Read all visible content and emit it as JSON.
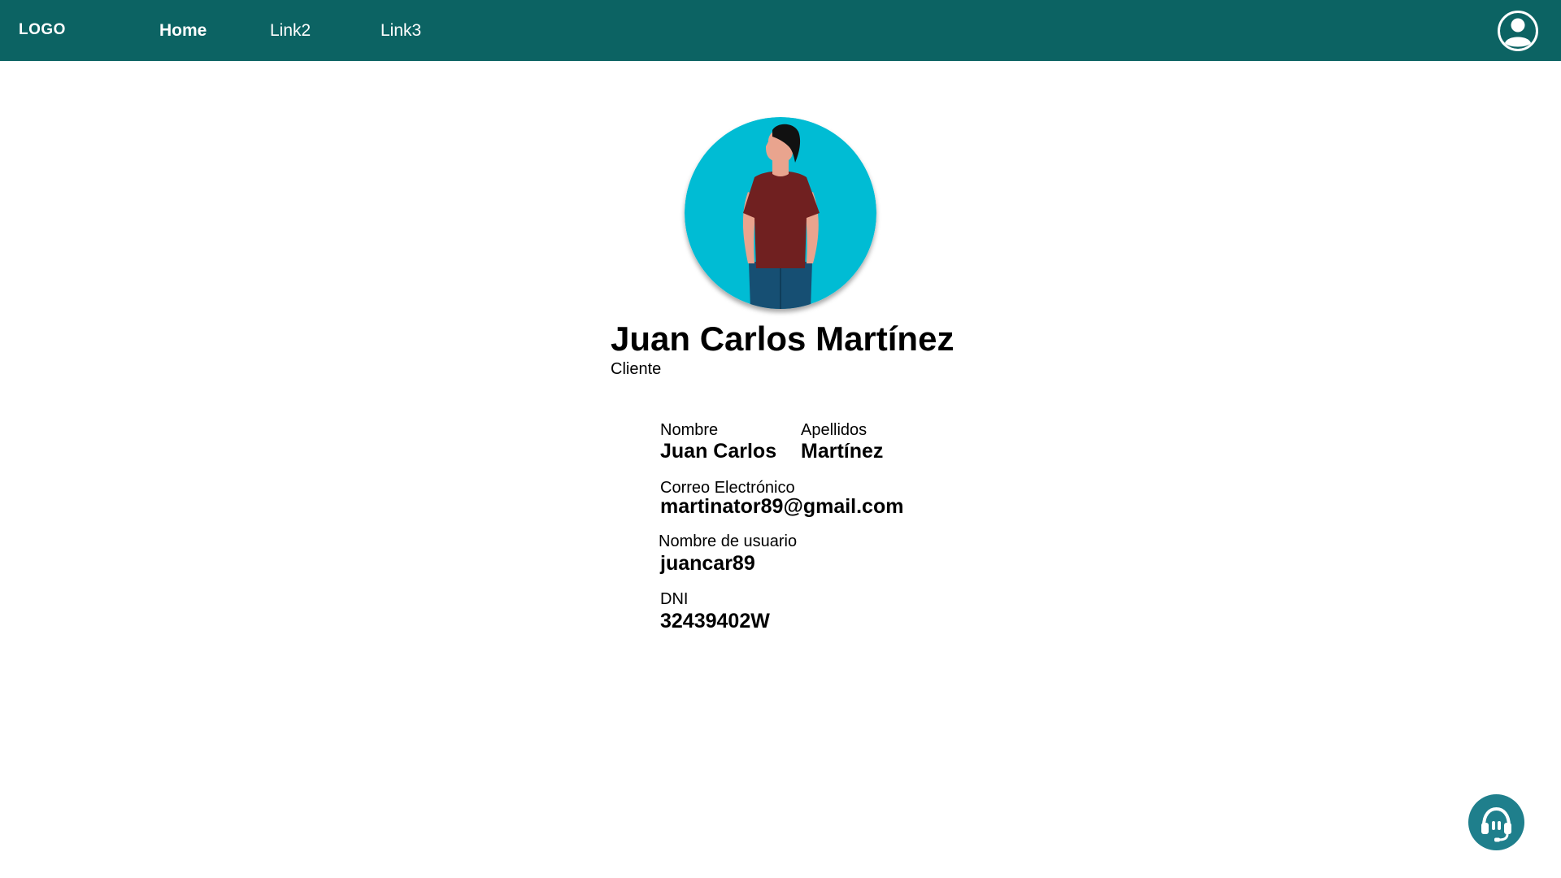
{
  "header": {
    "logo": "LOGO",
    "nav": [
      {
        "label": "Home",
        "active": true
      },
      {
        "label": "Link2",
        "active": false
      },
      {
        "label": "Link3",
        "active": false
      }
    ],
    "account_icon": "user-circle-icon",
    "colors": {
      "bar": "#0c6363",
      "text": "#ffffff"
    }
  },
  "profile": {
    "full_name": "Juan Carlos Martínez",
    "role": "Cliente",
    "avatar_colors": {
      "background": "#00bcd4",
      "shirt": "#702020",
      "pants": "#164f73"
    }
  },
  "fields": {
    "first_name": {
      "label": "Nombre",
      "value": "Juan Carlos"
    },
    "last_name": {
      "label": "Apellidos",
      "value": "Martínez"
    },
    "email": {
      "label": "Correo Electrónico",
      "value": "martinator89@gmail.com"
    },
    "username": {
      "label": "Nombre de usuario",
      "value": "juancar89"
    },
    "dni": {
      "label": "DNI",
      "value": "32439402W"
    }
  },
  "support": {
    "icon": "headset-icon",
    "color": "#1f7f8c"
  }
}
